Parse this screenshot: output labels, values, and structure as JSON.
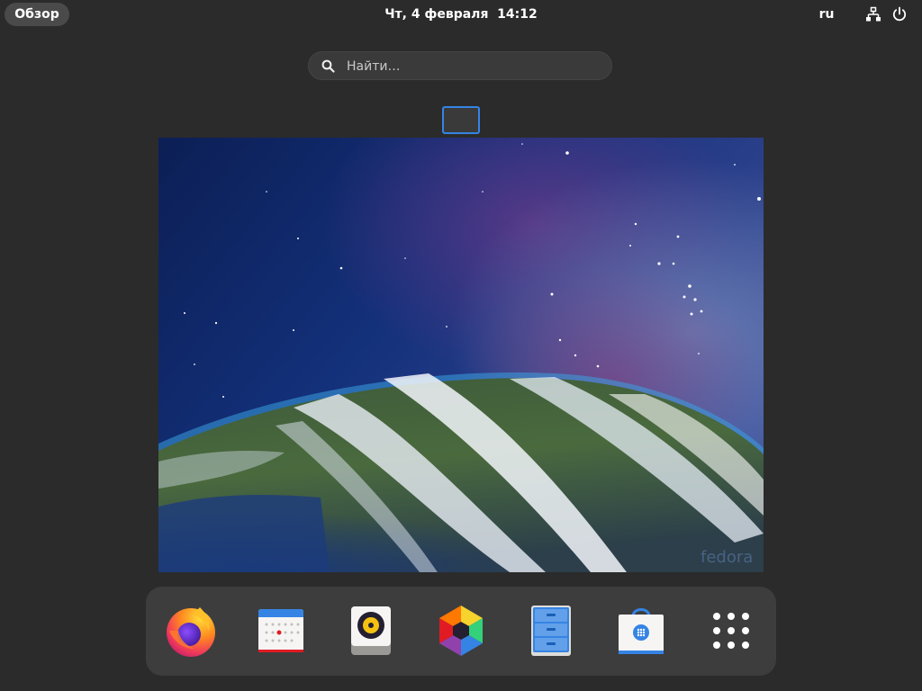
{
  "topbar": {
    "activities_label": "Обзор",
    "clock": "Чт, 4 февраля  14:12",
    "keyboard_layout": "ru"
  },
  "search": {
    "placeholder": "Найти…"
  },
  "wallpaper": {
    "watermark": "fedora"
  },
  "dock": {
    "items": [
      {
        "name": "Firefox",
        "icon": "firefox-icon"
      },
      {
        "name": "Calendar",
        "icon": "calendar-icon"
      },
      {
        "name": "Rhythmbox",
        "icon": "rhythmbox-icon"
      },
      {
        "name": "Photos",
        "icon": "photos-icon"
      },
      {
        "name": "Files",
        "icon": "files-icon"
      },
      {
        "name": "Software",
        "icon": "software-icon"
      },
      {
        "name": "Show Applications",
        "icon": "app-grid-icon"
      }
    ]
  },
  "colors": {
    "panel_bg": "#2b2b2b",
    "accent": "#3584e4",
    "dock_bg": "#3d3d3d"
  }
}
